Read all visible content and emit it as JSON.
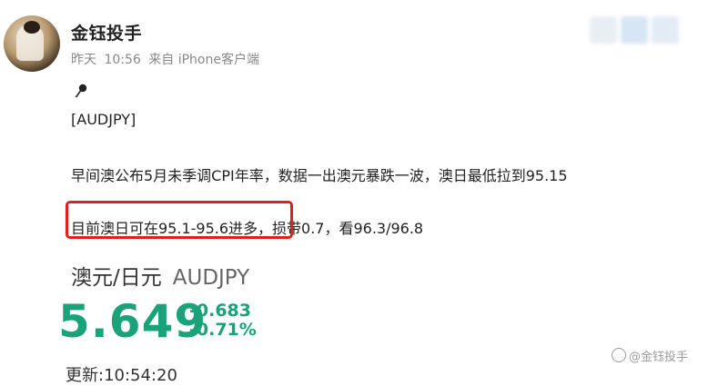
{
  "post": {
    "username": "金钰投手",
    "meta": {
      "day": "昨天",
      "time": "10:56",
      "source": "来自 iPhone客户端"
    },
    "icon": "pin-icon",
    "lines": [
      "[AUDJPY]",
      "早间澳公布5月未季调CPI年率，数据一出澳元暴跌一波，澳日最低拉到95.15",
      "目前澳日可在95.1-95.6进多，损带0.7，看96.3/96.8"
    ]
  },
  "quote": {
    "pair_cn": "澳元/日元",
    "pair_code": "AUDJPY",
    "price": "5.649",
    "change_abs": "-0.683",
    "change_pct": "-0.71%",
    "update_time": "更新:10:54:20"
  },
  "watermark": {
    "text": "@金钰投手"
  },
  "colors": {
    "accent_green": "#1aa37a",
    "highlight_red": "#e02020"
  }
}
